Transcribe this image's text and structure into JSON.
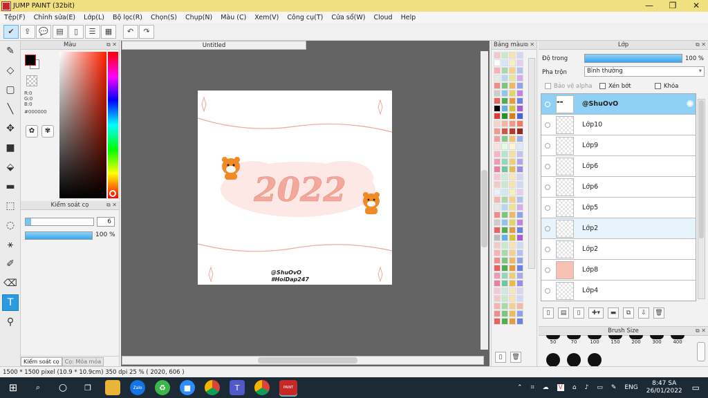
{
  "window": {
    "title": "JUMP PAINT (32bit)",
    "minimize": "—",
    "maximize": "❐",
    "close": "✕"
  },
  "menu": [
    "Tệp(F)",
    "Chỉnh sửa(E)",
    "Lớp(L)",
    "Bộ lọc(R)",
    "Chọn(S)",
    "Chụp(N)",
    "Màu (C)",
    "Xem(V)",
    "Công cụ(T)",
    "Cửa sổ(W)",
    "Cloud",
    "Help"
  ],
  "color_panel": {
    "title": "Màu",
    "r": "R:0",
    "g": "G:0",
    "b": "B:0",
    "hex": "#000000"
  },
  "brush_panel": {
    "title": "Kiểm soát cọ",
    "size": "6",
    "opacity": "100 %",
    "opacity_fraction": 1.0,
    "tab_active": "Kiểm soát cọ",
    "tab_inactive": "Cọ: Mỏa mỏa"
  },
  "document": {
    "tab": "Untitled",
    "year": "2022",
    "tag1": "@ShuOvO",
    "tag2": "#HoiDap247"
  },
  "swatch_panel": {
    "title": "Bảng màu"
  },
  "layer_panel": {
    "title": "Lớp",
    "opacity_label": "Độ trong",
    "opacity_value": "100 %",
    "blend_label": "Pha trộn",
    "blend_value": "Bình thường",
    "protect_alpha": "Bảo vệ alpha",
    "clipping": "Xén bớt",
    "lock": "Khóa",
    "layers": [
      {
        "name": "@ShuOvO"
      },
      {
        "name": "Lớp10"
      },
      {
        "name": "Lớp9"
      },
      {
        "name": "Lớp6"
      },
      {
        "name": "Lớp6"
      },
      {
        "name": "Lớp5"
      },
      {
        "name": "Lớp2"
      },
      {
        "name": "Lớp2"
      },
      {
        "name": "Lớp8"
      },
      {
        "name": "Lớp4"
      }
    ]
  },
  "brush_size": {
    "title": "Brush Size",
    "sizes": [
      "50",
      "70",
      "100",
      "150",
      "200",
      "300",
      "400"
    ]
  },
  "status": "1500 * 1500 pixel   (10.9 * 10.9cm)   350 dpi   25 %   ( 2020, 606 )",
  "taskbar": {
    "lang": "ENG",
    "time": "8:47 SA",
    "date": "26/01/2022"
  },
  "colors": {
    "accent": "#2a9be0",
    "title_bar": "#f0e080",
    "layer_selected": "#8ed1f4",
    "peach": "#f2a89a"
  }
}
